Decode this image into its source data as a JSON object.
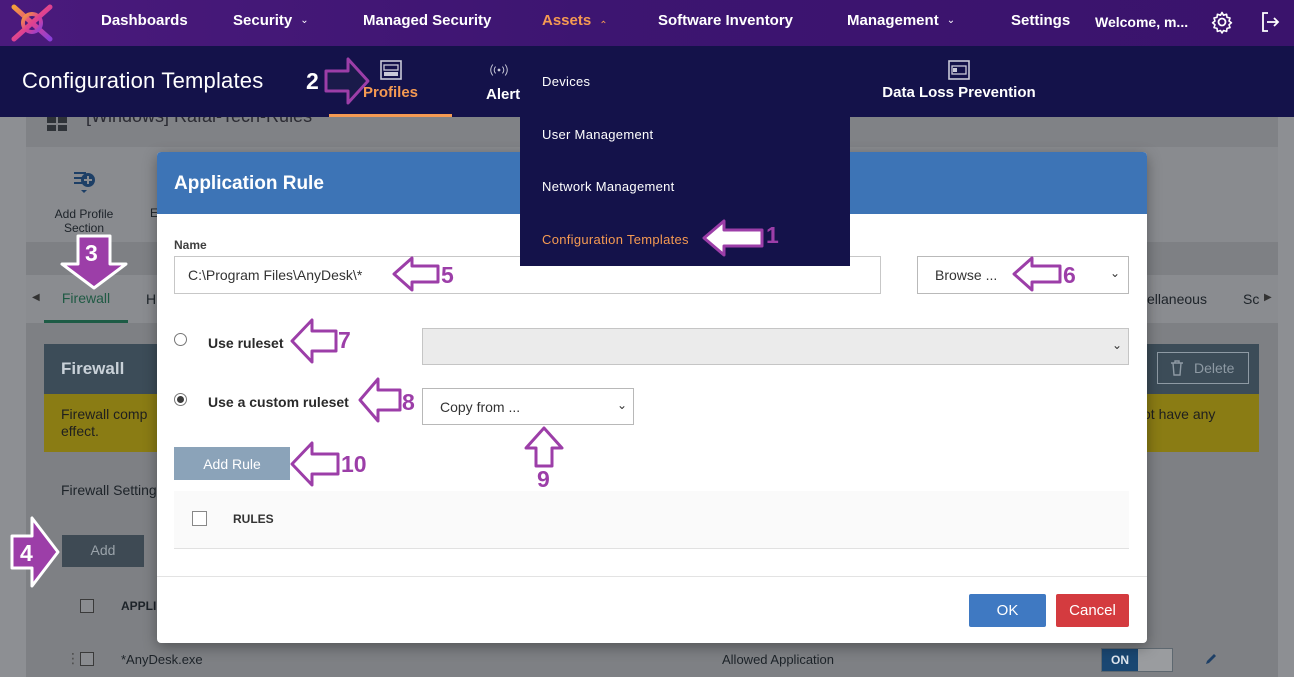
{
  "nav": {
    "items": [
      {
        "label": "Dashboards"
      },
      {
        "label": "Security"
      },
      {
        "label": "Managed Security"
      },
      {
        "label": "Assets"
      },
      {
        "label": "Software Inventory"
      },
      {
        "label": "Management"
      },
      {
        "label": "Settings"
      }
    ],
    "welcome": "Welcome, m...",
    "icons": [
      "settings-gear-icon",
      "logout-icon"
    ]
  },
  "subbar": {
    "page_title": "Configuration Templates",
    "tabs": [
      {
        "label": "Profiles",
        "icon": "profiles-icon"
      },
      {
        "label": "Alert",
        "icon": "broadcast-icon"
      },
      {
        "label": "Data Loss Prevention",
        "icon": "dlp-icon"
      }
    ]
  },
  "assets_menu": {
    "items": [
      {
        "label": "Devices"
      },
      {
        "label": "User Management"
      },
      {
        "label": "Network Management"
      },
      {
        "label": "Configuration Templates"
      }
    ]
  },
  "background": {
    "profile_title": "[Windows] Rafal-Tech-Rules",
    "add_profile_section": "Add Profile Section",
    "firewall_tab": "Firewall",
    "tab_fragment_h": "H",
    "tab_miscellaneous": "ellaneous",
    "tab_sc": "Sc",
    "firewall_header": "Firewall",
    "delete_label": "Delete",
    "warning_left": "Firewall comp",
    "warning_left_2": "effect.",
    "warning_right": "ot have any",
    "firewall_settings": "Firewall Setting",
    "add_label": "Add",
    "col_appl": "APPLI",
    "row_app": "*AnyDesk.exe",
    "row_status": "Allowed Application",
    "toggle_on": "ON",
    "fragment_e": "E"
  },
  "modal": {
    "title": "Application Rule",
    "name_label": "Name",
    "name_value": "C:\\Program Files\\AnyDesk\\*",
    "browse_label": "Browse ...",
    "use_ruleset_label": "Use ruleset",
    "use_custom_ruleset_label": "Use a custom ruleset",
    "custom_selected": true,
    "copy_from_label": "Copy from ...",
    "add_rule_label": "Add Rule",
    "rules_column": "RULES",
    "ok_label": "OK",
    "cancel_label": "Cancel"
  },
  "annotations": {
    "n1": "1",
    "n2": "2",
    "n3": "3",
    "n4": "4",
    "n5": "5",
    "n6": "6",
    "n7": "7",
    "n8": "8",
    "n9": "9",
    "n10": "10"
  },
  "colors": {
    "nav_bg": "#3d1571",
    "subbar_bg": "#14124a",
    "accent_orange": "#f59a52",
    "modal_header": "#3d74b6",
    "ok_button": "#3f79c2",
    "cancel_button": "#d43b3f",
    "annotation_purple": "#9c3ea8"
  }
}
